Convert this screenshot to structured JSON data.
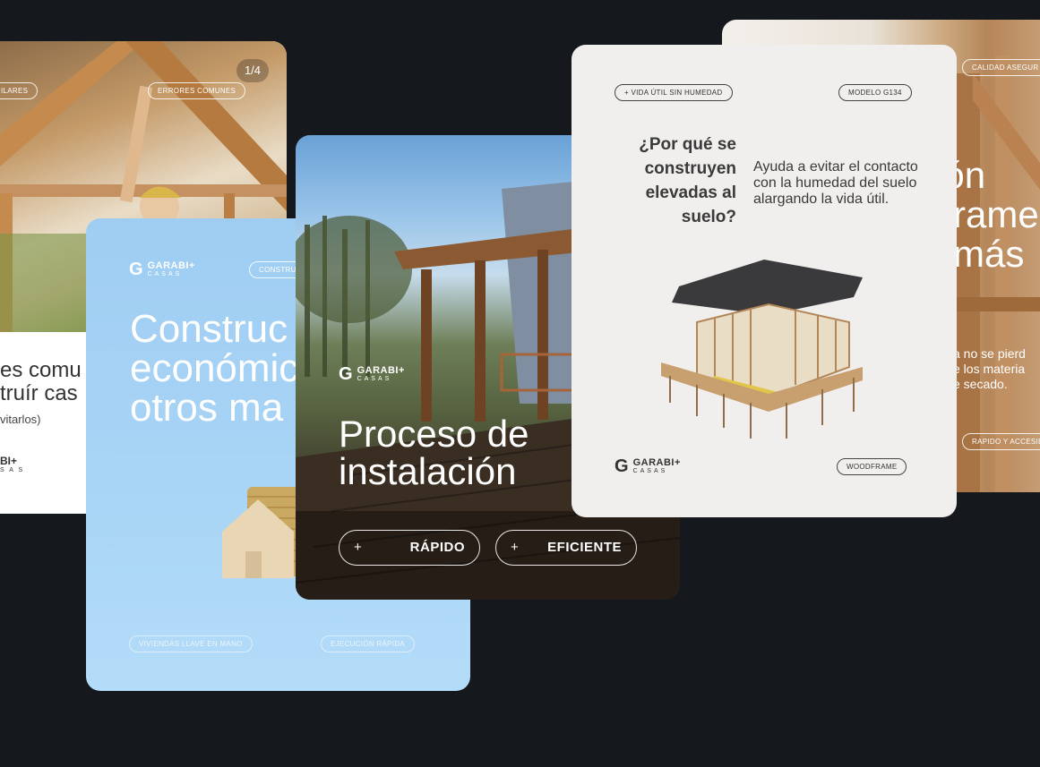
{
  "background_color": "#15181c",
  "card1": {
    "counter": "1/4",
    "pills": [
      "ILARES",
      "ERRORES COMUNES"
    ],
    "text_line1": "es comu",
    "text_line2": "truír cas",
    "subtext": "vitarlos)",
    "logo": "BI+",
    "logo_sub": "S A S"
  },
  "card2": {
    "logo_brand": "GARABI+",
    "logo_sub": "CASAS",
    "pill_top": "CONSTRU",
    "title_lines": [
      "Construc",
      "económic",
      "otros ma"
    ],
    "pills_bottom": [
      "VIVIENDAS LLAVE EN MANO",
      "EJECUCIÓN RÁPIDA"
    ]
  },
  "card3": {
    "logo_brand": "GARABI+",
    "logo_sub": "CASAS",
    "title_lines": [
      "Proceso de",
      "instalación"
    ],
    "btn1_plus": "+",
    "btn1_label": "RÁPIDO",
    "btn2_plus": "+",
    "btn2_label": "EFICIENTE"
  },
  "card4": {
    "pill_top": "CALIDAD ASEGUR",
    "big_lines": [
      "a",
      "ión",
      "rame",
      "más"
    ],
    "small_lines": [
      "a no se pierd",
      "e los materia",
      "e secado."
    ],
    "pill_bottom": "RAPIDO Y ACCESIB"
  },
  "card5": {
    "pill_left": "+ VIDA ÚTIL SIN HUMEDAD",
    "pill_right": "MODELO G134",
    "question": "¿Por qué se construyen elevadas al suelo?",
    "answer": "Ayuda a evitar el contacto con la humedad del suelo alargando la vida útil.",
    "logo_brand": "GARABI+",
    "logo_sub": "CASAS",
    "pill_bottom": "WOODFRAME"
  }
}
